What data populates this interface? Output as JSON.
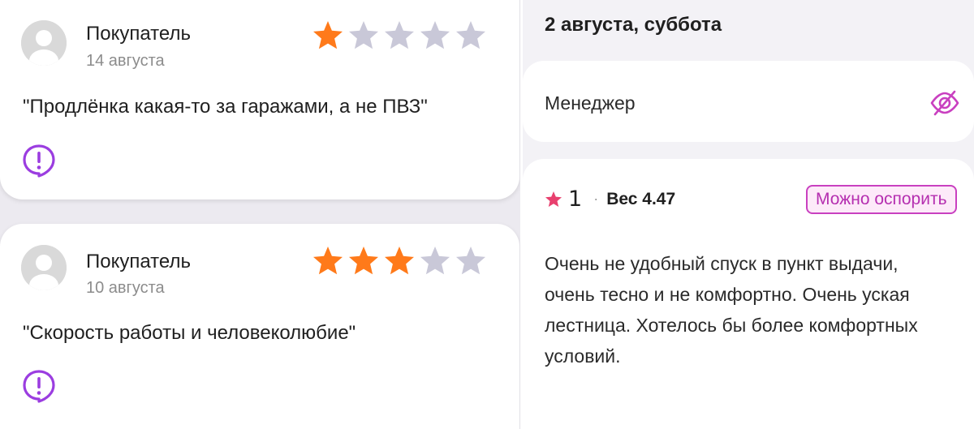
{
  "left_reviews": [
    {
      "author": "Покупатель",
      "date": "14 августа",
      "rating": 1,
      "max_rating": 5,
      "text": "\"Продлёнка какая-то за гаражами, а не ПВЗ\"",
      "icon": "complaint-icon"
    },
    {
      "author": "Покупатель",
      "date": "10 августа",
      "rating": 3,
      "max_rating": 5,
      "text": "\"Скорость работы и человеколюбие\"",
      "icon": "complaint-icon"
    }
  ],
  "right": {
    "day_title": "2 августа, суббота",
    "manager_label": "Менеджер",
    "manager_icon": "eye-off-icon",
    "rating_value": "1",
    "separator": "·",
    "weight": "Вес 4.47",
    "dispute_label": "Можно оспорить",
    "text": "Очень не удобный спуск в пункт выдачи, очень тесно и не комфортно. Очень уская лестница. Хотелось бы более комфортных условий."
  },
  "colors": {
    "star_active": "#ff7a1a",
    "star_inactive": "#c9c8d8",
    "accent_purple": "#9b3de0",
    "accent_pink": "#c940c0",
    "rating_star": "#e8406e"
  }
}
